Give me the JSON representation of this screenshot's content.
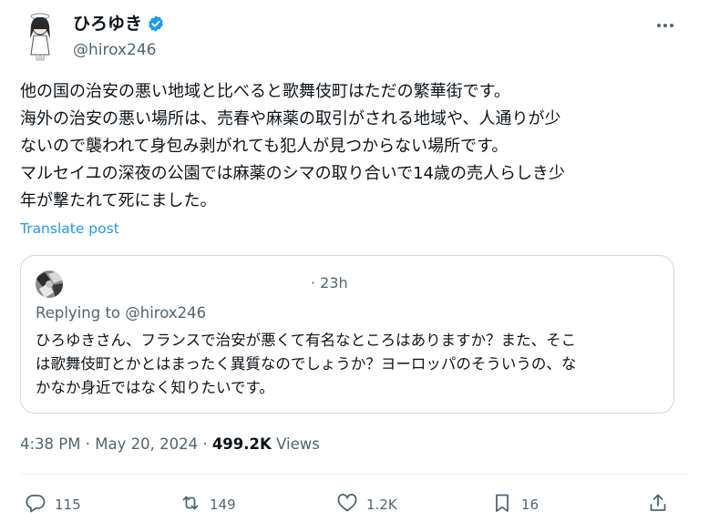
{
  "author": {
    "name": "ひろゆき",
    "handle": "@hirox246"
  },
  "tweet": {
    "lines": [
      "他の国の治安の悪い地域と比べると歌舞伎町はただの繁華街です。",
      "海外の治安の悪い場所は、売春や麻薬の取引がされる地域や、人通りが少",
      "ないので襲われて身包み剥がれても犯人が見つからない場所です。",
      "マルセイユの深夜の公園では麻薬のシマの取り合いで14歳の売人らしき少",
      "年が撃たれて死にました。"
    ],
    "translate_label": "Translate post"
  },
  "quote": {
    "time": "· 23h",
    "replying": "Replying to @hirox246",
    "lines": [
      "ひろゆきさん、フランスで治安が悪くて有名なところはありますか？また、そこ",
      "は歌舞伎町とかとはまったく異質なのでしょうか？ヨーロッパのそういうの、な",
      "かなか身近ではなく知りたいです。"
    ]
  },
  "meta": {
    "time": "4:38 PM",
    "sep1": "·",
    "date": "May 20, 2024",
    "sep2": "·",
    "views_count": "499.2K",
    "views_label": "Views"
  },
  "actions": {
    "replies": "115",
    "reposts": "149",
    "likes": "1.2K",
    "bookmarks": "16"
  },
  "colors": {
    "link": "#1d9bf0",
    "muted": "#536471",
    "text": "#0f1419",
    "border": "#cfd9de"
  },
  "icons": [
    "verified-badge-icon",
    "more-icon",
    "reply-icon",
    "repost-icon",
    "like-icon",
    "bookmark-icon",
    "share-icon"
  ]
}
